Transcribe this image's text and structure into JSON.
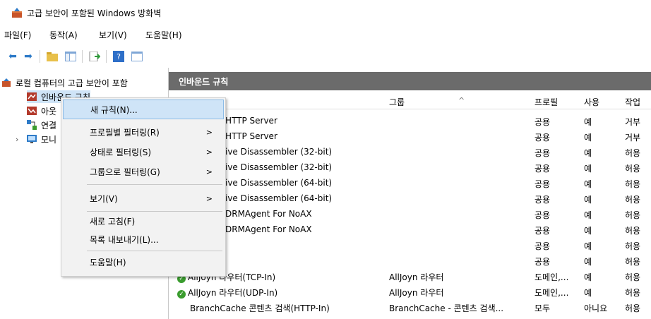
{
  "window": {
    "title": "고급 보안이 포함된 Windows 방화벽"
  },
  "menu": [
    "파일(F)",
    "동작(A)",
    "보기(V)",
    "도움말(H)"
  ],
  "tree": {
    "root": "로컬 컴퓨터의 고급 보안이 포함",
    "items": [
      "인바운드 규칙",
      "아웃",
      "연결",
      "모니"
    ]
  },
  "panel": {
    "header": "인바운드 규칙"
  },
  "columns": {
    "group": "그룹",
    "profile": "프로필",
    "enabled": "사용",
    "action": "작업"
  },
  "rows": [
    {
      "name": "HTTP Server",
      "group": "",
      "profile": "공용",
      "enabled": "예",
      "action": "거부"
    },
    {
      "name": "HTTP Server",
      "group": "",
      "profile": "공용",
      "enabled": "예",
      "action": "거부"
    },
    {
      "name": "ive Disassembler (32-bit)",
      "group": "",
      "profile": "공용",
      "enabled": "예",
      "action": "허용"
    },
    {
      "name": "ive Disassembler (32-bit)",
      "group": "",
      "profile": "공용",
      "enabled": "예",
      "action": "허용"
    },
    {
      "name": "ive Disassembler (64-bit)",
      "group": "",
      "profile": "공용",
      "enabled": "예",
      "action": "허용"
    },
    {
      "name": "ive Disassembler (64-bit)",
      "group": "",
      "profile": "공용",
      "enabled": "예",
      "action": "허용"
    },
    {
      "name": "DRMAgent For NoAX",
      "group": "",
      "profile": "공용",
      "enabled": "예",
      "action": "허용"
    },
    {
      "name": "DRMAgent For NoAX",
      "group": "",
      "profile": "공용",
      "enabled": "예",
      "action": "허용"
    },
    {
      "name": "",
      "group": "",
      "profile": "공용",
      "enabled": "예",
      "action": "허용"
    },
    {
      "name": "",
      "group": "",
      "profile": "공용",
      "enabled": "예",
      "action": "허용"
    },
    {
      "name": "AllJoyn 라우터(TCP-In)",
      "group": "AllJoyn 라우터",
      "profile": "도메인,...",
      "enabled": "예",
      "action": "허용"
    },
    {
      "name": "AllJoyn 라우터(UDP-In)",
      "group": "AllJoyn 라우터",
      "profile": "도메인,...",
      "enabled": "예",
      "action": "허용"
    },
    {
      "name": "BranchCache 콘텐츠 검색(HTTP-In)",
      "group": "BranchCache - 콘텐츠 검색...",
      "profile": "모두",
      "enabled": "아니요",
      "action": "허용"
    }
  ],
  "context_menu": {
    "items": [
      "새 규칙(N)...",
      "프로필별 필터링(R)",
      "상태로 필터링(S)",
      "그룹으로 필터링(G)",
      "보기(V)",
      "새로 고침(F)",
      "목록 내보내기(L)...",
      "도움말(H)"
    ]
  },
  "colors": {
    "panel_header": "#6b6b6b",
    "highlight": "#cfe4f7",
    "check_green": "#3a9c2e"
  }
}
